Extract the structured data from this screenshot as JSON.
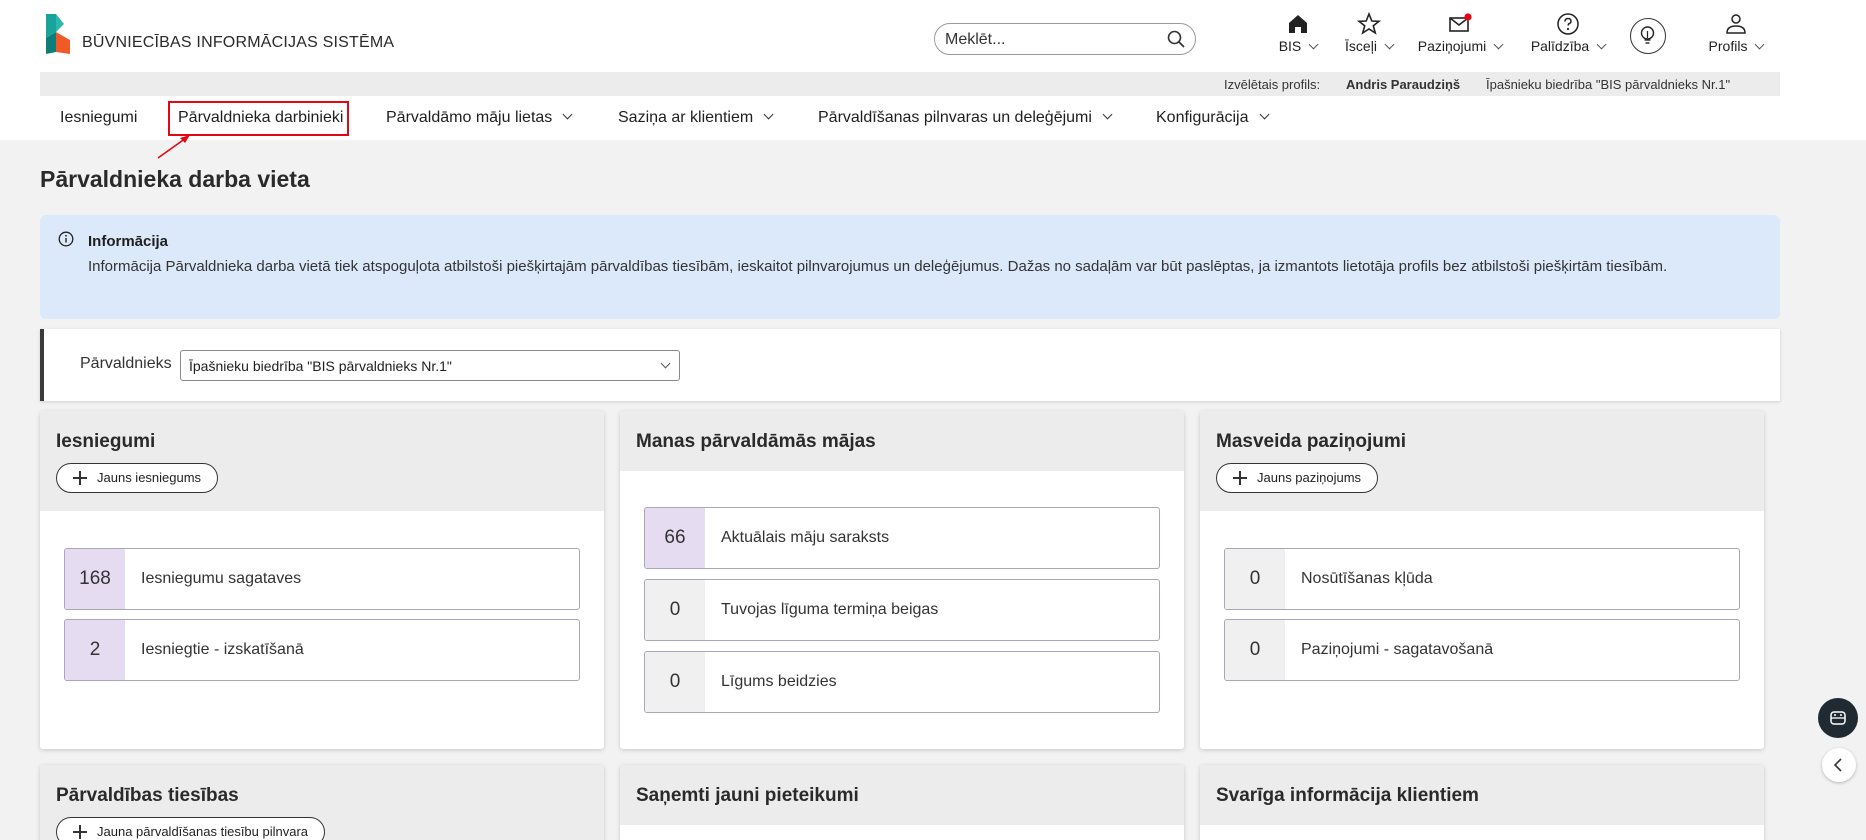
{
  "header": {
    "logo_text": "Būvniecības informācijas sistēma",
    "search_placeholder": "Meklēt...",
    "nav": [
      {
        "label": "BIS",
        "icon": "home-icon"
      },
      {
        "label": "Īsceļi",
        "icon": "star-icon"
      },
      {
        "label": "Paziņojumi",
        "icon": "mail-icon"
      },
      {
        "label": "Palīdzība",
        "icon": "help-icon"
      },
      {
        "label": "Profils",
        "icon": "user-icon"
      }
    ],
    "bulb_icon": "lightbulb-icon"
  },
  "profile_strip": {
    "prefix": "Izvēlētais profils:",
    "user": "Andris Paraudziņš",
    "org": "Īpašnieku biedrība \"BIS pārvaldnieks Nr.1\""
  },
  "main_nav": [
    {
      "label": "Iesniegumi"
    },
    {
      "label": "Pārvaldnieka darbinieki"
    },
    {
      "label": "Pārvaldāmo māju lietas"
    },
    {
      "label": "Saziņa ar klientiem"
    },
    {
      "label": "Pārvaldīšanas pilnvaras un deleģējumi"
    },
    {
      "label": "Konfigurācija"
    }
  ],
  "page": {
    "title": "Pārvaldnieka darba vieta"
  },
  "info": {
    "title": "Informācija",
    "text": "Informācija Pārvaldnieka darba vietā tiek atspoguļota atbilstoši piešķirtajām pārvaldības tiesībām, ieskaitot pilnvarojumus un deleģējumus. Dažas no sadaļām var būt paslēptas, ja izmantots lietotāja profils bez atbilstoši piešķirtām tiesībām."
  },
  "manager": {
    "label": "Pārvaldnieks",
    "selected": "Īpašnieku biedrība \"BIS pārvaldnieks Nr.1\""
  },
  "cards": {
    "submissions": {
      "title": "Iesniegumi",
      "button": "Jauns iesniegums",
      "stats": [
        {
          "value": "168",
          "label": "Iesniegumu sagataves"
        },
        {
          "value": "2",
          "label": "Iesniegtie - izskatīšanā"
        }
      ]
    },
    "houses": {
      "title": "Manas pārvaldāmās mājas",
      "stats": [
        {
          "value": "66",
          "label": "Aktuālais māju saraksts"
        },
        {
          "value": "0",
          "label": "Tuvojas līguma termiņa beigas"
        },
        {
          "value": "0",
          "label": "Līgums beidzies"
        }
      ]
    },
    "mass_notices": {
      "title": "Masveida paziņojumi",
      "button": "Jauns paziņojums",
      "stats": [
        {
          "value": "0",
          "label": "Nosūtīšanas kļūda"
        },
        {
          "value": "0",
          "label": "Paziņojumi - sagatavošanā"
        }
      ]
    },
    "rights": {
      "title": "Pārvaldības tiesības",
      "button": "Jauna pārvaldīšanas tiesību pilnvara"
    },
    "applications": {
      "title": "Saņemti jauni pieteikumi"
    },
    "client_info": {
      "title": "Svarīga informācija klientiem"
    }
  },
  "side_buttons": {
    "chat_icon": "chatbot-icon",
    "collapse_icon": "chevron-left-icon"
  }
}
